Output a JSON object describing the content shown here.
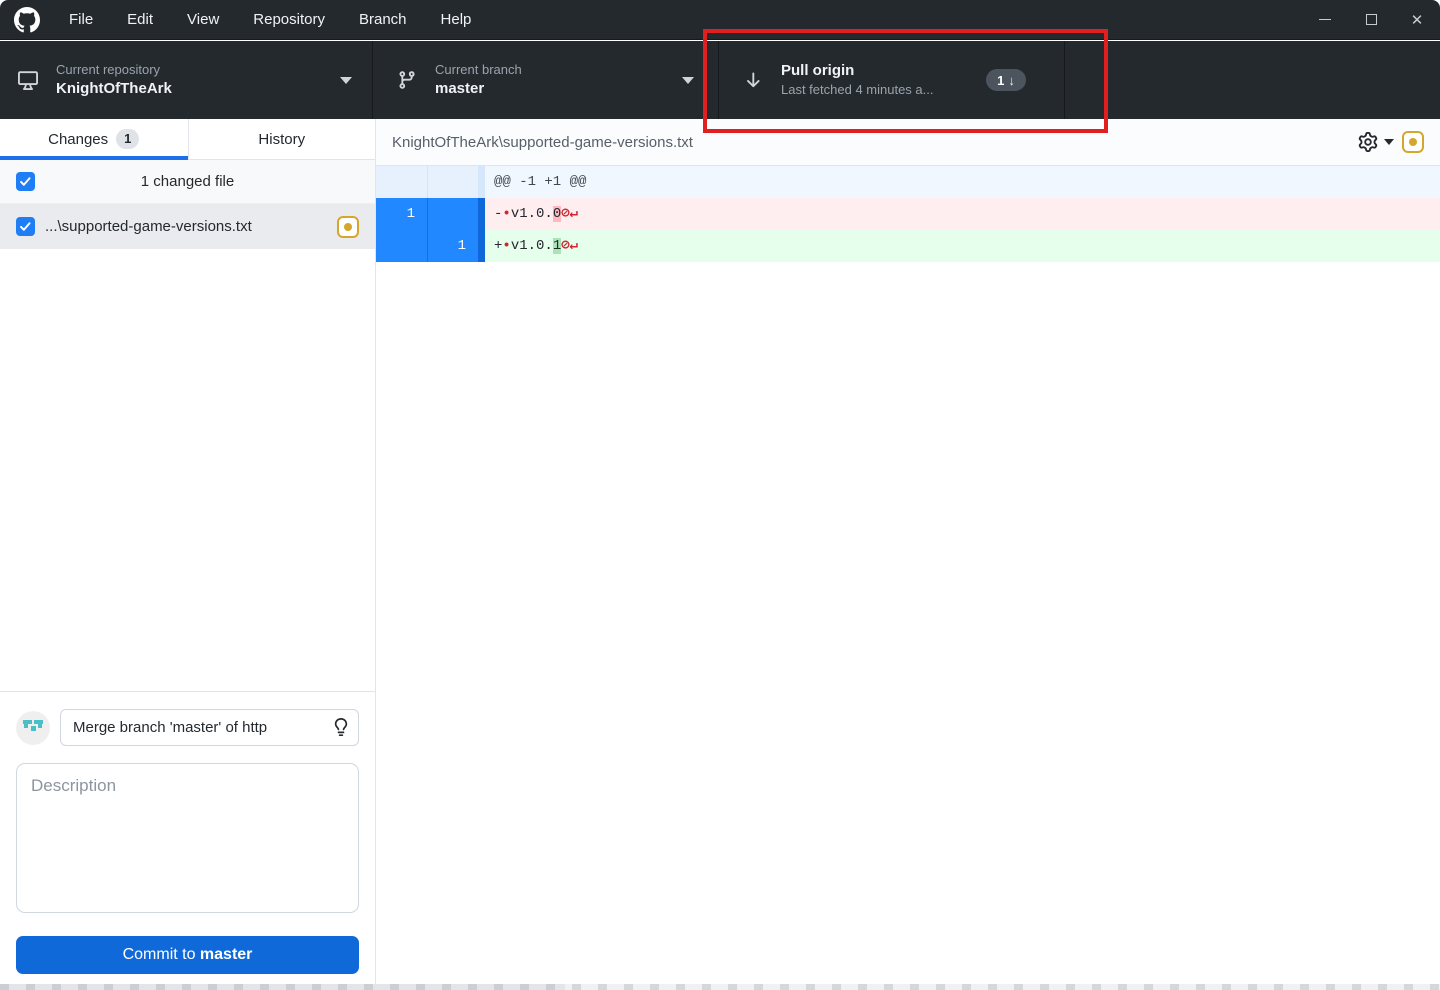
{
  "colors": {
    "titlebar_bg": "#24292e",
    "accent_blue": "#1069d9",
    "selected_gutter_blue": "#2188ff",
    "tab_underline_blue": "#1f6feb",
    "annotation_red": "#e02020",
    "modified_yellow": "#d4a72c",
    "diff_removed_bg": "#ffeef0",
    "diff_added_bg": "#e6ffec",
    "diff_word_removed": "#ffb8c0",
    "diff_word_added": "#a8e4b6",
    "hidden_char_red": "#d1242f"
  },
  "titlebar": {
    "menu_items": [
      "File",
      "Edit",
      "View",
      "Repository",
      "Branch",
      "Help"
    ],
    "controls": {
      "close_glyph": "✕"
    }
  },
  "toolbar": {
    "repository": {
      "label": "Current repository",
      "value": "KnightOfTheArk"
    },
    "branch": {
      "label": "Current branch",
      "value": "master"
    },
    "pull": {
      "title": "Pull origin",
      "subtitle": "Last fetched 4 minutes a...",
      "badge": {
        "count": "1",
        "arrow": "↓"
      }
    }
  },
  "sidebar": {
    "tabs": [
      {
        "label": "Changes",
        "badge": "1",
        "active": true
      },
      {
        "label": "History",
        "active": false
      }
    ],
    "summary_row": {
      "label": "1 changed file",
      "checked": true
    },
    "files": [
      {
        "name": "...\\supported-game-versions.txt",
        "status": "modified",
        "checked": true
      }
    ],
    "commit": {
      "summary": {
        "value": "Merge branch 'master' of http"
      },
      "description": {
        "placeholder": "Description"
      },
      "button": {
        "prefix": "Commit to ",
        "branch": "master"
      }
    }
  },
  "main": {
    "file_header": {
      "path": "KnightOfTheArk\\supported-game-versions.txt"
    },
    "diff": {
      "hunk_header": "@@ -1 +1 @@",
      "lines": [
        {
          "type": "removed",
          "old_number": "1",
          "new_number": "",
          "sign": "-",
          "space_marker": "•",
          "text": "v1.0.",
          "changed_char": "0",
          "no_newline_marker": "⊘",
          "line_ending_marker": "↵"
        },
        {
          "type": "added",
          "old_number": "",
          "new_number": "1",
          "sign": "+",
          "space_marker": "•",
          "text": "v1.0.",
          "changed_char": "1",
          "no_newline_marker": "⊘",
          "line_ending_marker": "↵"
        }
      ]
    }
  },
  "annotation": {
    "shape": "red-rectangle",
    "highlights": "Pull origin button"
  }
}
